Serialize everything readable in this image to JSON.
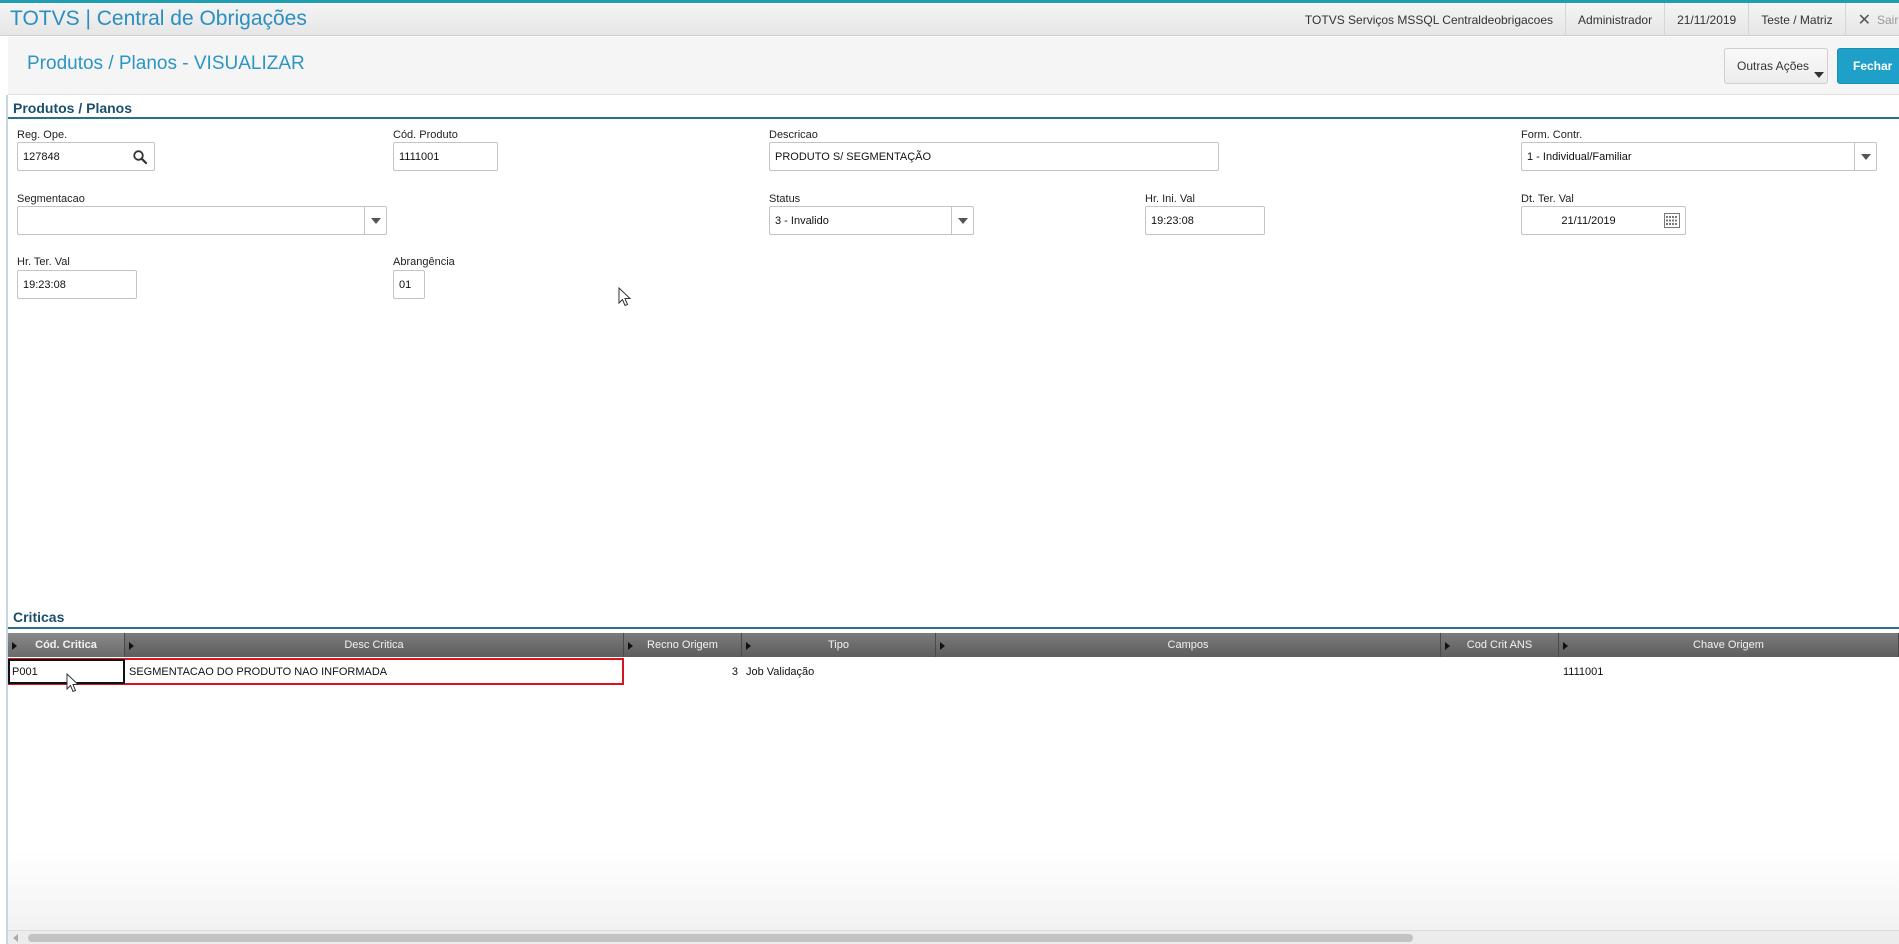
{
  "app": {
    "title": "TOTVS | Central de Obrigações"
  },
  "topbar": {
    "environment": "TOTVS Serviços MSSQL Centraldeobrigacoes",
    "user": "Administrador",
    "date": "21/11/2019",
    "branch": "Teste / Matriz",
    "exit_label": "Sair"
  },
  "page": {
    "title": "Produtos / Planos - VISUALIZAR",
    "actions": {
      "other": "Outras Ações",
      "close": "Fechar"
    }
  },
  "form": {
    "section_title": "Produtos / Planos",
    "fields": {
      "reg_ope": {
        "label": "Reg. Ope.",
        "value": "127848"
      },
      "cod_produto": {
        "label": "Cód. Produto",
        "value": "1111001"
      },
      "descricao": {
        "label": "Descricao",
        "value": "PRODUTO S/ SEGMENTAÇÃO"
      },
      "form_contr": {
        "label": "Form. Contr.",
        "value": "1 - Individual/Familiar"
      },
      "segmentacao": {
        "label": "Segmentacao",
        "value": ""
      },
      "status": {
        "label": "Status",
        "value": "3 - Invalido"
      },
      "hr_ini_val": {
        "label": "Hr. Ini. Val",
        "value": "19:23:08"
      },
      "dt_ter_val": {
        "label": "Dt. Ter. Val",
        "value": "21/11/2019"
      },
      "hr_ter_val": {
        "label": "Hr. Ter. Val",
        "value": "19:23:08"
      },
      "abrangencia": {
        "label": "Abrangência",
        "value": "01"
      }
    }
  },
  "criticas": {
    "section_title": "Criticas",
    "columns": [
      "Cód. Critica",
      "Desc Critica",
      "Recno Origem",
      "Tipo",
      "Campos",
      "Cod Crit ANS",
      "Chave Origem"
    ],
    "rows": [
      {
        "cod_critica": "P001",
        "desc_critica": "SEGMENTACAO DO PRODUTO NAO INFORMADA",
        "recno_origem": "3",
        "tipo": "Job Validação",
        "campos": "",
        "cod_crit_ans": "",
        "chave_origem": "1111001"
      }
    ]
  },
  "colors": {
    "accent": "#2a8fc0",
    "primary_button": "#1fa0c8",
    "section_title": "#1b4f6e",
    "grid_header": "#6a6a6a",
    "highlight": "#d9141e"
  }
}
